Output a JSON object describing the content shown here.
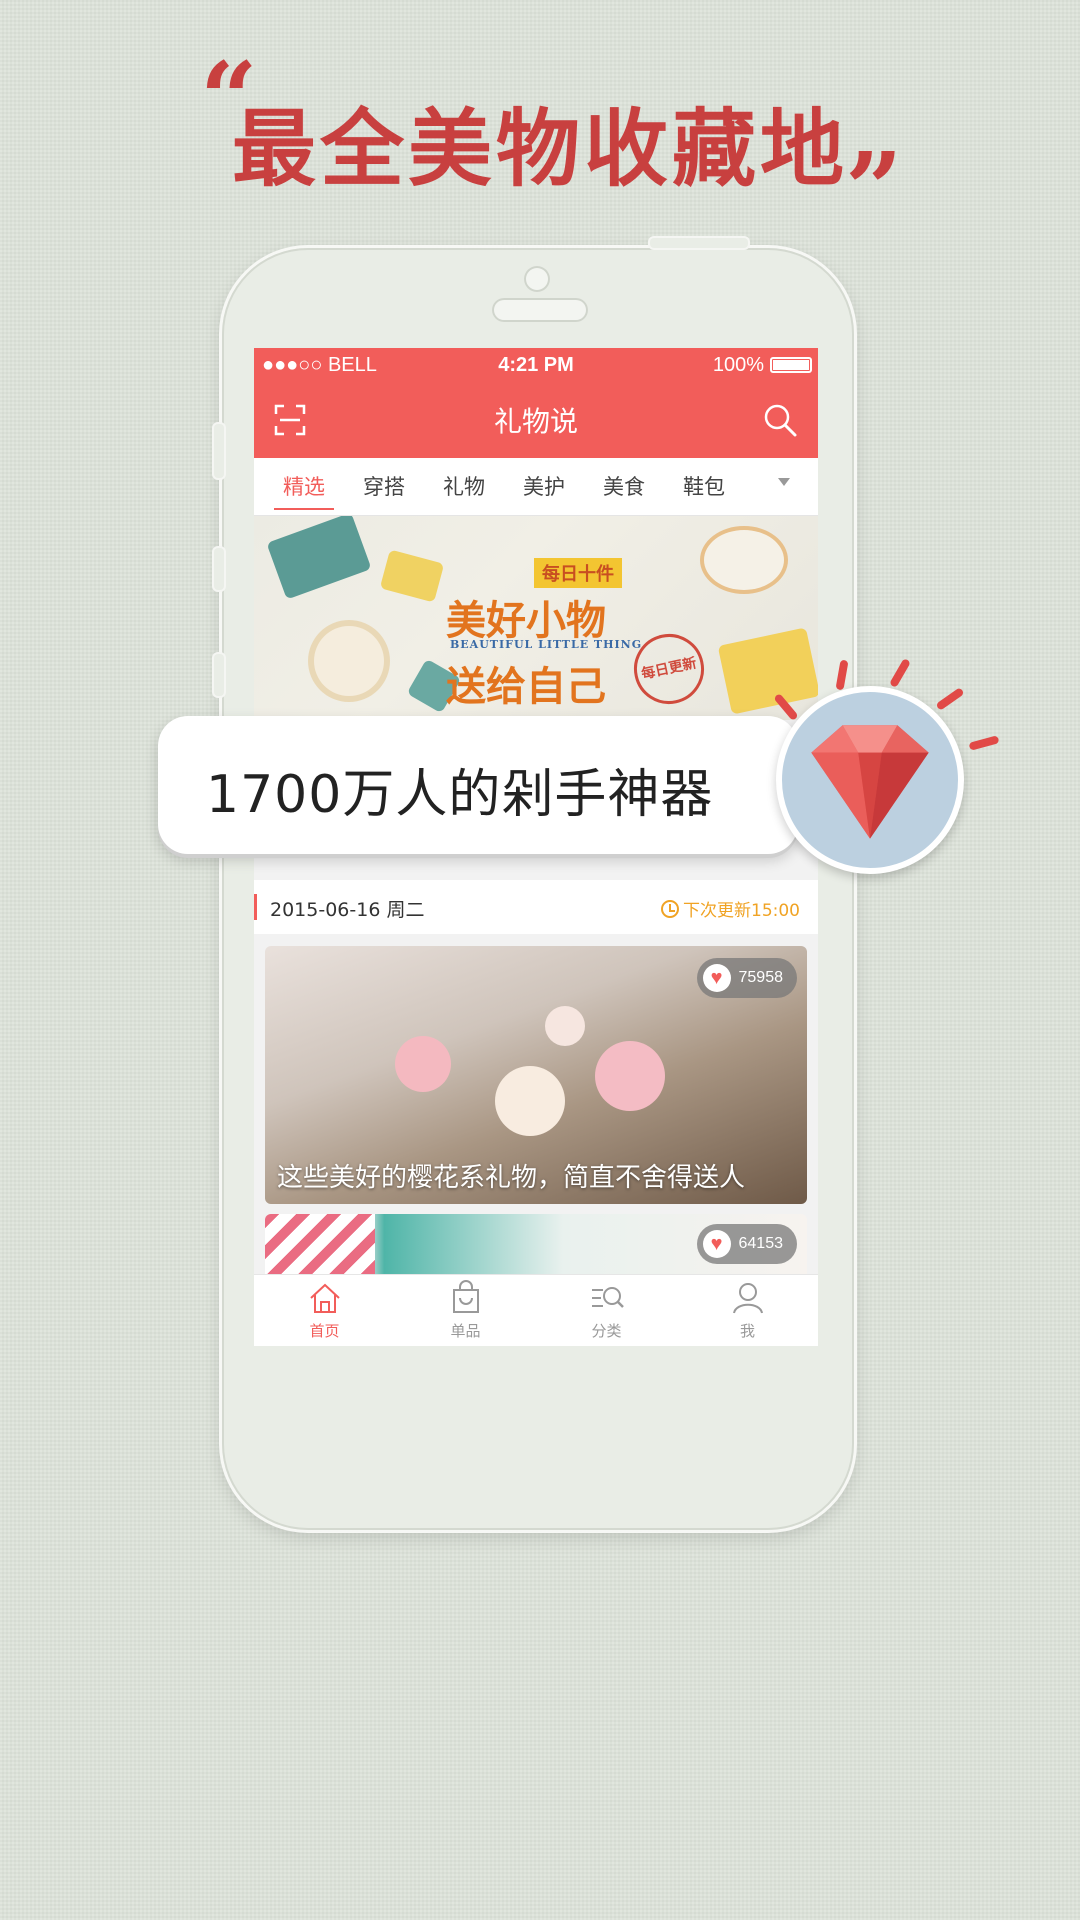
{
  "headline": {
    "text": "最全美物收藏地",
    "open_quote": "“",
    "close_quote": "”"
  },
  "status_bar": {
    "carrier": "●●●○○ BELL",
    "time": "4:21 PM",
    "battery": "100%"
  },
  "app": {
    "title": "礼物说"
  },
  "tabs": [
    {
      "label": "精选"
    },
    {
      "label": "穿搭"
    },
    {
      "label": "礼物"
    },
    {
      "label": "美护"
    },
    {
      "label": "美食"
    },
    {
      "label": "鞋包"
    }
  ],
  "banner": {
    "tag": "每日十件",
    "title_line1": "美好小物",
    "subtitle": "BEAUTIFUL LITTLE THING",
    "title_line2": "送给自己",
    "stamp": "每日更新"
  },
  "overlay": {
    "text": "1700万人的剁手神器"
  },
  "feed": {
    "date": "2015-06-16 周二",
    "next_update": "下次更新15:00",
    "cards": [
      {
        "likes": "75958",
        "caption": "这些美好的樱花系礼物，简直不舍得送人"
      },
      {
        "likes": "64153",
        "caption": ""
      }
    ]
  },
  "tabbar": [
    {
      "label": "首页",
      "icon": "home-icon"
    },
    {
      "label": "单品",
      "icon": "bag-icon"
    },
    {
      "label": "分类",
      "icon": "category-search-icon"
    },
    {
      "label": "我",
      "icon": "user-icon"
    }
  ],
  "colors": {
    "accent": "#f25d5a",
    "headline": "#c8403f",
    "update": "#f0a324"
  }
}
